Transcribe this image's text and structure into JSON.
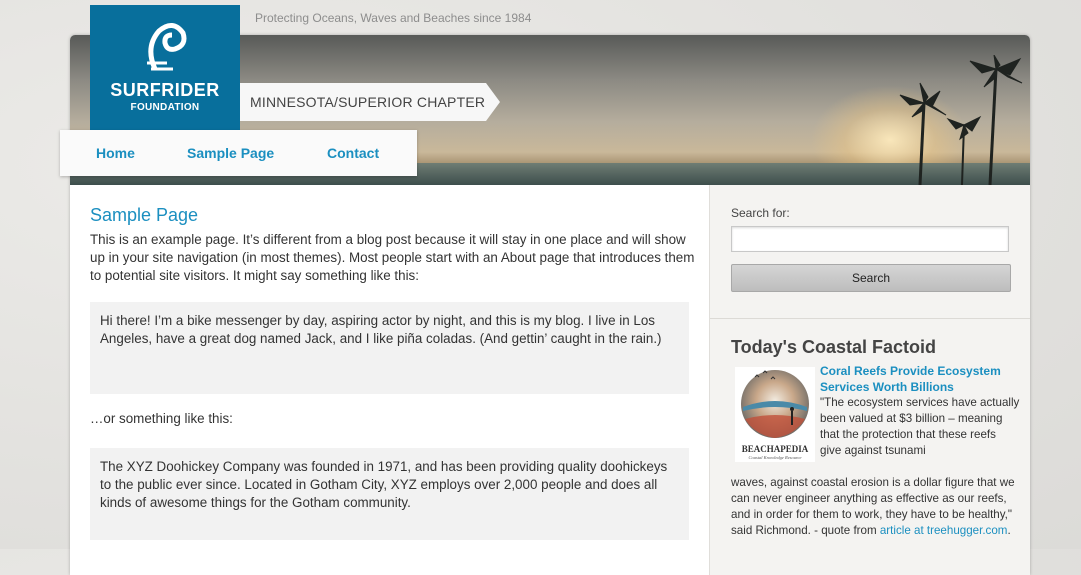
{
  "site": {
    "tagline": "Protecting Oceans, Waves and Beaches since 1984",
    "logo_line1": "SURFRIDER",
    "logo_line2": "FOUNDATION",
    "chapter": "MINNESOTA/SUPERIOR CHAPTER",
    "brand_color": "#086f9c",
    "link_color": "#1b8fc0"
  },
  "nav": {
    "items": [
      {
        "label": "Home"
      },
      {
        "label": "Sample Page"
      },
      {
        "label": "Contact"
      }
    ]
  },
  "main": {
    "title": "Sample Page",
    "intro": "This is an example page. It’s different from a blog post because it will stay in one place and will show up in your site navigation (in most themes). Most people start with an About page that introduces them to potential site visitors. It might say something like this:",
    "quote1": "Hi there! I’m a bike messenger by day, aspiring actor by night, and this is my blog. I live in Los Angeles, have a great dog named Jack, and I like piña coladas. (And gettin’ caught in the rain.)",
    "middle": "…or something like this:",
    "quote2": "The XYZ Doohickey Company was founded in 1971, and has been providing quality doohickeys to the public ever since. Located in Gotham City, XYZ employs over 2,000 people and does all kinds of awesome things for the Gotham community."
  },
  "sidebar": {
    "search_label": "Search for:",
    "search_value": "",
    "search_button": "Search",
    "factoid_heading": "Today's Coastal Factoid",
    "factoid_image_brand": "BEACHAPEDIA",
    "factoid_image_sub": "Coastal Knowledge Resource",
    "factoid_title": "Coral Reefs Provide Ecosystem Services Worth Billions",
    "factoid_text_a": "\"The ecosystem services have actually been valued at $3 billion – meaning that the protection that these reefs give against tsunami",
    "factoid_text_b": "waves, against coastal erosion is a dollar figure that we can never engineer anything as effective as our reefs, and in order for them to work, they have to be healthy,\" said Richmond. - quote from ",
    "factoid_link": "article at treehugger.com",
    "factoid_end": "."
  }
}
